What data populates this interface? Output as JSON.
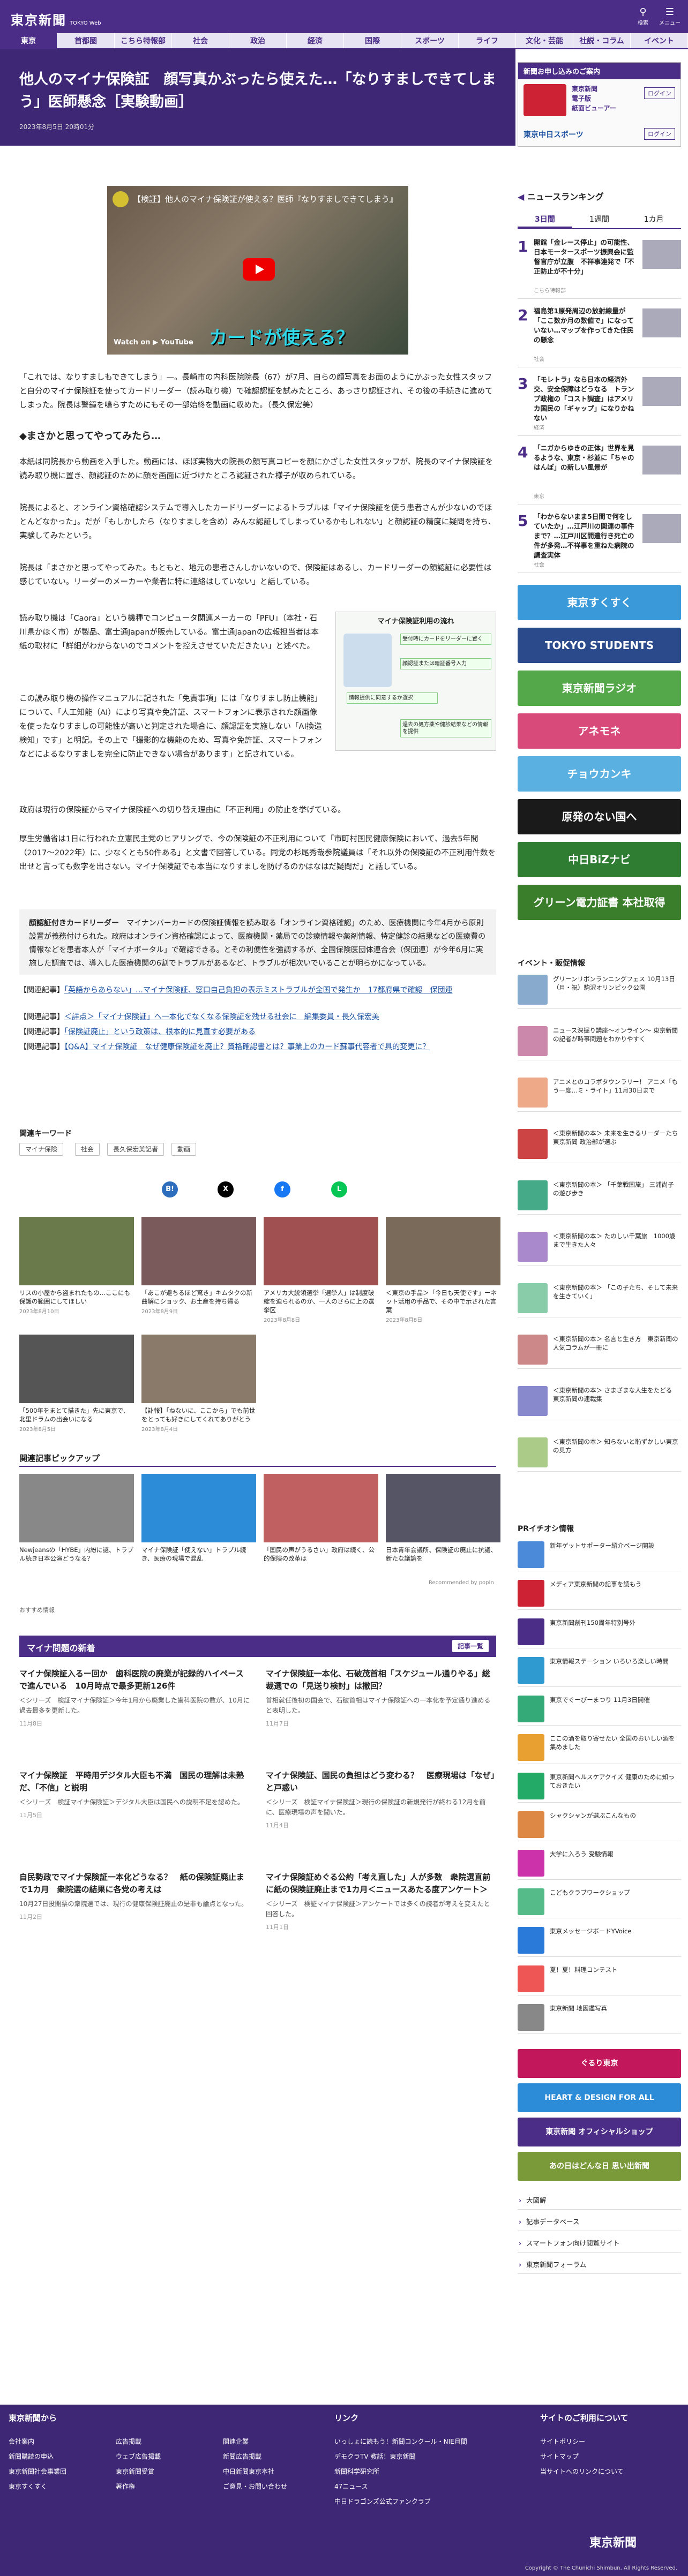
{
  "header": {
    "logo": "東京新聞",
    "logo_sub": "TOKYO Web",
    "search_label": "検索",
    "menu_label": "メニュー"
  },
  "nav": [
    "東京",
    "首都圏",
    "こちら特報部",
    "社会",
    "政治",
    "経済",
    "国際",
    "スポーツ",
    "ライフ",
    "文化・芸能",
    "社説・コラム",
    "イベント"
  ],
  "article": {
    "title": "他人のマイナ保険証　顔写真かぶったら使えた…「なりすましできてしまう」医師懸念［実験動画］",
    "date": "2023年8月5日 20時01分",
    "video_title": "【検証】他人のマイナ保険証が使える？医師『なりすましできてしまう』",
    "video_caption": "カードが使える？",
    "video_watch": "Watch on ▶ YouTube",
    "p1": "「これでは、なりすましもできてしまう」—。長崎市の内科医院院長（67）が7月、自らの顔写真をお面のようにかぶった女性スタッフと自分のマイナ保険証を使ってカードリーダー（読み取り機）で確認認証を試みたところ、あっさり認証され、その後の手続きに進めてしまった。院長は警鐘を鳴らすためにもその一部始終を動画に収めた。（長久保宏美）",
    "h1": "◆まさかと思ってやってみたら…",
    "p2": "本紙は同院長から動画を入手した。動画には、ほぼ実物大の院長の顔写真コピーを顔にかざした女性スタッフが、院長のマイナ保険証を読み取り機に置き、顔認証のために顔を画面に近づけたところ認証された様子が収められている。",
    "p3": "院長によると、オンライン資格確認システムで導入したカードリーダーによるトラブルは「マイナ保険証を使う患者さんが少ないのでほとんどなかった」。だが「もしかしたら（なりすましを含め）みんな認証してしまっているかもしれない」と顔認証の精度に疑問を持ち、実験してみたという。",
    "p4": "院長は「まさかと思ってやってみた。もともと、地元の患者さんしかいないので、保険証はあるし、カードリーダーの顔認証に必要性は感じていない。リーダーのメーカーや業者に特に連絡はしていない」と話している。",
    "p5": "読み取り機は「Caora」という機種でコンピュータ関連メーカーの「PFU」（本社・石川県かほく市）が製品、富士通Japanが販売している。富士通Japanの広報担当者は本紙の取材に「詳細がわからないのでコメントを控えさせていただきたい」と述べた。",
    "p6": "この読み取り機の操作マニュアルに記された「免責事項」には「なりすまし防止機能」について、「人工知能（AI）により写真や免許証、スマートフォンに表示された顔画像を使ったなりすましの可能性が高いと判定された場合に、顔認証を実施しない「AI換造検知」です」と明記。その上で「撮影的な機能のため、写真や免許証、スマートフォンなどによるなりすましを完全に防止できない場合があります」と記されている。",
    "p7": "政府は現行の保険証からマイナ保険証への切り替え理由に「不正利用」の防止を挙げている。",
    "p8": "厚生労働省は1日に行われた立憲民主党のヒアリングで、今の保険証の不正利用について「市町村国民健康保険において、過去5年間（2017〜2022年）に、少なくとも50件ある」と文書で回答している。同党の杉尾秀哉参院議員は「それ以外の保険証の不正利用件数を出せと言っても数字を出さない。マイナ保険証でも本当になりすましを防げるのかはなはだ疑問だ」と話している。",
    "note_label": "顔認証付きカードリーダー",
    "note": "　マイナンバーカードの保険証情報を読み取る「オンライン資格確認」のため、医療機関に今年4月から原則設置が義務付けられた。政府はオンライン資格確認によって、医療機関・薬局での診療情報や薬剤情報、特定健診の結果などの医療費の情報などを患者本人が「マイナポータル」で確認できる。とその利便性を強調するが、全国保険医団体連合会（保団連）が今年6月に実施した調査では、導入した医療機関の6割でトラブルがあるなど、トラブルが相次いでいることが明らかになっている。",
    "related": [
      {
        "label": "【関連記事】",
        "text": "「英語からあらない」…マイナ保険証、窓口自己負担の表示ミストラブルが全国で発生か　17都府県で確認　保団連"
      },
      {
        "label": "【関連記事】",
        "text": "＜詳点＞「マイナ保険証」へ一本化でなくなる保険証を残せる社会に　編集委員・長久保宏美"
      },
      {
        "label": "【関連記事】",
        "text": "「保険証廃止」という政策は、根本的に見直す必要がある"
      },
      {
        "label": "【関連記事】",
        "text": "【Q&A】マイナ保険証　なぜ健康保険証を廃止？資格確認書とは？事業上のカード蘇事代容者で具的変更に？"
      }
    ],
    "keywords_title": "関連キーワード",
    "keywords": [
      "マイナ保険",
      "社会",
      "長久保宏美記者",
      "動画"
    ],
    "share": [
      "B!",
      "X",
      "f",
      "L"
    ]
  },
  "figure": {
    "title": "マイナ保険証利用の流れ",
    "steps": [
      "受付時にカードをリーダーに置く",
      "顔認証または暗証番号入力",
      "情報提供に同意するか選択",
      "過去の処方薬や健診結果などの情報を提供"
    ]
  },
  "photo_cards": [
    {
      "caption": "リスの小屋から盗まれたもの…ここにも保護の範囲にしてほしい",
      "date": "2023年8月10日"
    },
    {
      "caption": "「あこが避ちるほど驚き」キムタクの新曲解にショック、お土産を持ち帰る",
      "date": "2023年8月9日"
    },
    {
      "caption": "アメリカ大統領選挙「選挙人」は制度破綻を迫られるのか、一人のさらに上の選挙区",
      "date": "2023年8月8日"
    },
    {
      "caption": "＜東京の手品＞「今日も天使です」ーネット活用の手品で、その中で示された言葉",
      "date": "2023年8月8日"
    },
    {
      "caption": "「500年をまとて描きた」先に東京で、北里ドラムの出会いになる",
      "date": "2023年8月5日"
    },
    {
      "caption": "【訃報】「ねないに、ここから」でも前世をとっても好きにしてくれてありがとう",
      "date": "2023年8月4日"
    }
  ],
  "pickup": {
    "title": "関連記事ピックアップ",
    "items": [
      {
        "caption": "Newjeansの「HYBE」内紛に謎、トラブル続き日本公演どうなる？"
      },
      {
        "caption": "マイナ保険証「使えない」トラブル続き、医療の現場で混乱"
      },
      {
        "caption": "「国民の声がうるさい」政府は続く、公的保険の改革は"
      },
      {
        "caption": "日本青年会議所、保険証の廃止に抗議、新たな議論を"
      }
    ],
    "recommended": "Recommended by popIn"
  },
  "special": {
    "header": "マイナ問題の新着",
    "more": "記事一覧",
    "label": "おすすめ情報",
    "items": [
      {
        "title": "マイナ保険証入るー回か　歯科医院の廃業が記録的ハイペースで進んでいる　10月時点で最多更新126件",
        "desc": "＜シリーズ　検証マイナ保険証＞今年1月から廃業した歯科医院の数が、10月に過去最多を更新した。",
        "date": "11月8日"
      },
      {
        "title": "マイナ保険証一本化、石破茂首相「スケジュール通りやる」総裁選での「見送り検討」は撤回？",
        "desc": "首相就任後初の国会で、石破首相はマイナ保険証への一本化を予定通り進めると表明した。",
        "date": "11月7日"
      },
      {
        "title": "マイナ保険証　平時用デジタル大臣も不満　国民の理解は未熟だ、「不信」と説明",
        "desc": "＜シリーズ　検証マイナ保険証＞デジタル大臣は国民への説明不足を認めた。",
        "date": "11月5日"
      },
      {
        "title": "マイナ保険証、国民の負担はどう変わる？　医療現場は「なぜ」と戸惑い",
        "desc": "＜シリーズ　検証マイナ保険証＞現行の保険証の新規発行が終わる12月を前に、医療現場の声を聞いた。",
        "date": "11月4日"
      },
      {
        "title": "自民勢政でマイナ保険証一本化どうなる？　紙の保険証廃止まで1カ月　衆院選の結果に各党の考えは",
        "desc": "10月27日投開票の衆院選では、現行の健康保険証廃止の是非も論点となった。",
        "date": "11月2日"
      },
      {
        "title": "マイナ保険証めぐる公約「考え直した」人が多数　衆院選直前に紙の保険証廃止まで1カ月＜ニュースあたる度アンケート＞",
        "desc": "＜シリーズ　検証マイナ保険証＞アンケートでは多くの読者が考えを変えたと回答した。",
        "date": "11月1日"
      }
    ]
  },
  "sidebar": {
    "promo_title": "新聞お申し込みのご案内",
    "promo_lines": [
      "東京新聞",
      "電子版",
      "紙面ビューアー",
      "東京中日スポーツ"
    ],
    "promo_login": "ログイン",
    "ranking_title": "ニュースランキング",
    "ranking_tabs": [
      "3日間",
      "1週間",
      "1カ月"
    ],
    "ranking": [
      {
        "title": "開館「金レース停止」の可能性、日本モータースポーツ振興会に監督官庁が立腹　不祥事連発で「不正防止が不十分」",
        "cat": "こちら特報部"
      },
      {
        "title": "福島第1原発周辺の放射線量が「ここ数か月の数値で」になっていない…マップを作ってきた住民の懸念",
        "cat": "社会"
      },
      {
        "title": "「モレトラ」なら日本の経済外交、安全保障はどうなる　トランプ政権の「コスト調査」はアメリカ国民の「ギャップ」になりかねない",
        "cat": "経済"
      },
      {
        "title": "「ニガからゆきの正体」世界を見るような、東京・杉並に「ちゃのはんぽ」の新しい風景が",
        "cat": "東京"
      },
      {
        "title": "「わからないまま5日間で何をしていたか」…江戸川の関連の事件まで？…江戸川区間遺行き死亡の件が多発…不祥事を重ねた病院の調査実体",
        "cat": "社会"
      }
    ],
    "event_title": "イベント・販促情報",
    "events": [
      "グリーンリボンランニングフェス 10月13日（月・祝）駒沢オリンピック公園",
      "ニュース深掘り講座〜オンライン〜 東京新聞の記者が時事問題をわかりやすく",
      "アニメとのコラボタウンラリー！ アニメ「もう一度…ミ・ライト」11月30日まで",
      "＜東京新聞の本＞ 未来を生きるリーダーたち 東京新聞 政治部が選ぶ",
      "＜東京新聞の本＞ 「千葉戦国旅」 三浦尚子の遊び歩き",
      "＜東京新聞の本＞ たのしい千葉旅　1000歳まで生きた人々",
      "＜東京新聞の本＞ 「この子たち、そして未来を生きていく」",
      "＜東京新聞の本＞ 名言と生き方　東京新聞の人気コラムが一冊に",
      "＜東京新聞の本＞ さまざまな人生をたどる　東京新聞の連載集",
      "＜東京新聞の本＞ 知らないと恥ずかしい東京の見方"
    ],
    "pr_title": "PRイチオシ情報",
    "pr": [
      "新年ゲットサポーター紹介ページ開設",
      "メディア東京新聞の記事を読もう",
      "東京新聞創刊150周年特別号外",
      "東京情報ステーション いろいろ楽しい時間",
      "東京でぐーびーまつり 11月3日開催",
      "ここの酒を取り寄せたい 全国のおいしい酒を集めました",
      "東京新聞ヘルスケアクイズ 健康のために知っておきたい",
      "シャクシャンが選ぶこんなもの",
      "大学に入ろう 受験情報",
      "こどもクラブワークショップ",
      "東京メッセージボードYVoice",
      "夏！夏！料理コンテスト",
      "東京新聞 地図鑑写真"
    ],
    "banners": [
      "東京すくすく",
      "TOKYO STUDENTS",
      "東京新聞ラジオ",
      "アネモネ",
      "チョウカンキ",
      "原発のない国へ",
      "中日BiZナビ",
      "グリーン電力証書 本社取得"
    ],
    "banners2": [
      "ぐるり東京",
      "HEART & DESIGN FOR ALL",
      "東京新聞 オフィシャルショップ",
      "あの日はどんな日 思い出新聞"
    ],
    "links": [
      "大図解",
      "記事データベース",
      "スマートフォン向け閲覧サイト",
      "東京新聞フォーラム"
    ]
  },
  "footer": {
    "cols": [
      {
        "head": "東京新聞から",
        "items": [
          "会社案内",
          "新聞購読の申込",
          "東京新聞社会事業団",
          "東京すくすく"
        ]
      },
      {
        "head": "",
        "items": [
          "広告掲載",
          "ウェブ広告掲載",
          "東京新聞受賞",
          "著作権"
        ]
      },
      {
        "head": "",
        "items": [
          "関連企業",
          "新聞広告掲載",
          "中日新聞東京本社",
          "ご意見・お問い合わせ"
        ]
      },
      {
        "head": "リンク",
        "items": [
          "いっしょに読もう！新聞コンクール・NIE月間",
          "デモクラTV 教話！東京新聞",
          "新聞科学研究所",
          "47ニュース",
          "中日ドラゴンズ公式ファンクラブ"
        ]
      },
      {
        "head": "サイトのご利用について",
        "items": [
          "サイトポリシー",
          "サイトマップ",
          "当サイトへのリンクについて"
        ]
      }
    ],
    "logo": "東京新聞",
    "copyright": "Copyright © The Chunichi Shimbun, All Rights Reserved."
  }
}
